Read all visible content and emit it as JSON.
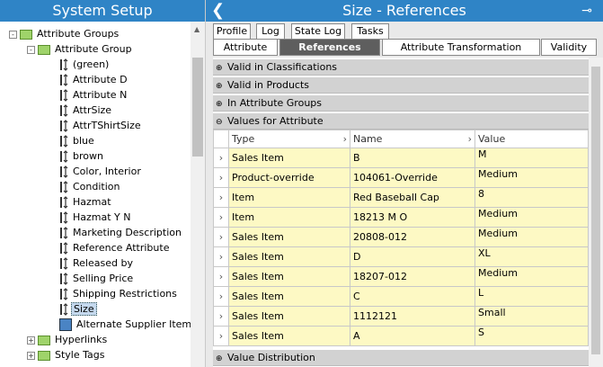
{
  "left": {
    "title": "System Setup",
    "tree": [
      {
        "label": "Attribute Groups",
        "level": 0,
        "type": "folder",
        "expander": "-"
      },
      {
        "label": "Attribute Group",
        "level": 1,
        "type": "folder",
        "expander": "-"
      },
      {
        "label": "(green)",
        "level": 2,
        "type": "attr"
      },
      {
        "label": "Attribute D",
        "level": 2,
        "type": "attr"
      },
      {
        "label": "Attribute N",
        "level": 2,
        "type": "attr"
      },
      {
        "label": "AttrSize",
        "level": 2,
        "type": "attr"
      },
      {
        "label": "AttrTShirtSize",
        "level": 2,
        "type": "attr"
      },
      {
        "label": "blue",
        "level": 2,
        "type": "attr"
      },
      {
        "label": "brown",
        "level": 2,
        "type": "attr"
      },
      {
        "label": "Color, Interior",
        "level": 2,
        "type": "attr"
      },
      {
        "label": "Condition",
        "level": 2,
        "type": "attr"
      },
      {
        "label": "Hazmat",
        "level": 2,
        "type": "attr"
      },
      {
        "label": "Hazmat Y N",
        "level": 2,
        "type": "attr"
      },
      {
        "label": "Marketing Description",
        "level": 2,
        "type": "attr"
      },
      {
        "label": "Reference Attribute",
        "level": 2,
        "type": "attr"
      },
      {
        "label": "Released by",
        "level": 2,
        "type": "attr"
      },
      {
        "label": "Selling Price",
        "level": 2,
        "type": "attr"
      },
      {
        "label": "Shipping Restrictions",
        "level": 2,
        "type": "attr"
      },
      {
        "label": "Size",
        "level": 2,
        "type": "attr",
        "selected": true
      },
      {
        "label": "Alternate Supplier Item",
        "level": 2,
        "type": "cube"
      },
      {
        "label": "Hyperlinks",
        "level": 1,
        "type": "folder",
        "expander": "+"
      },
      {
        "label": "Style Tags",
        "level": 1,
        "type": "folder",
        "expander": "+"
      }
    ]
  },
  "right": {
    "title": "Size - References",
    "tabs_row1": [
      "Profile",
      "Log",
      "State Log",
      "Tasks"
    ],
    "tabs_row2": [
      "Attribute",
      "References",
      "Attribute Transformation",
      "Validity"
    ],
    "active_tab": "References",
    "sections": [
      "Valid in Classifications",
      "Valid in Products",
      "In Attribute Groups",
      "Values for Attribute",
      "Value Distribution"
    ],
    "table": {
      "headers": [
        "Type",
        "Name",
        "Value"
      ],
      "rows": [
        [
          "Sales Item",
          "B",
          "M"
        ],
        [
          "Product-override",
          "104061-Override",
          "Medium"
        ],
        [
          "Item",
          "Red Baseball Cap",
          "8"
        ],
        [
          "Item",
          "18213 M O",
          "Medium"
        ],
        [
          "Sales Item",
          "20808-012",
          "Medium"
        ],
        [
          "Sales Item",
          "D",
          "XL"
        ],
        [
          "Sales Item",
          "18207-012",
          "Medium"
        ],
        [
          "Sales Item",
          "C",
          "L"
        ],
        [
          "Sales Item",
          "1112121",
          "Small"
        ],
        [
          "Sales Item",
          "A",
          "S"
        ]
      ]
    }
  },
  "colors": {
    "header": "#2f84c6",
    "row_highlight": "#fdf9c4",
    "active_tab": "#5e5e5e"
  }
}
